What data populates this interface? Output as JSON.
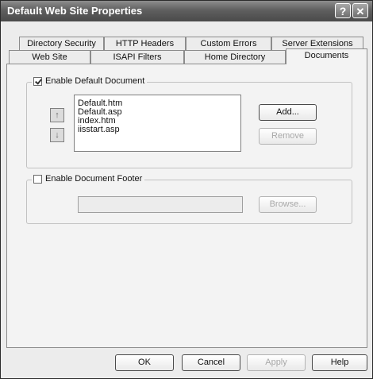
{
  "window": {
    "title": "Default Web Site Properties",
    "help_glyph": "?",
    "close_glyph": "✕"
  },
  "tabs": {
    "row1": [
      "Directory Security",
      "HTTP Headers",
      "Custom Errors",
      "Server Extensions"
    ],
    "row2": [
      "Web Site",
      "ISAPI Filters",
      "Home Directory",
      "Documents"
    ],
    "selected": "Documents"
  },
  "default_document": {
    "checkbox_label": "Enable Default Document",
    "checked": true,
    "files": [
      "Default.htm",
      "Default.asp",
      "index.htm",
      "iisstart.asp"
    ],
    "move_up_glyph": "↑",
    "move_down_glyph": "↓",
    "add_label": "Add...",
    "remove_label": "Remove"
  },
  "document_footer": {
    "checkbox_label": "Enable Document Footer",
    "checked": false,
    "path_value": "",
    "browse_label": "Browse..."
  },
  "buttons": {
    "ok": "OK",
    "cancel": "Cancel",
    "apply": "Apply",
    "help": "Help"
  }
}
